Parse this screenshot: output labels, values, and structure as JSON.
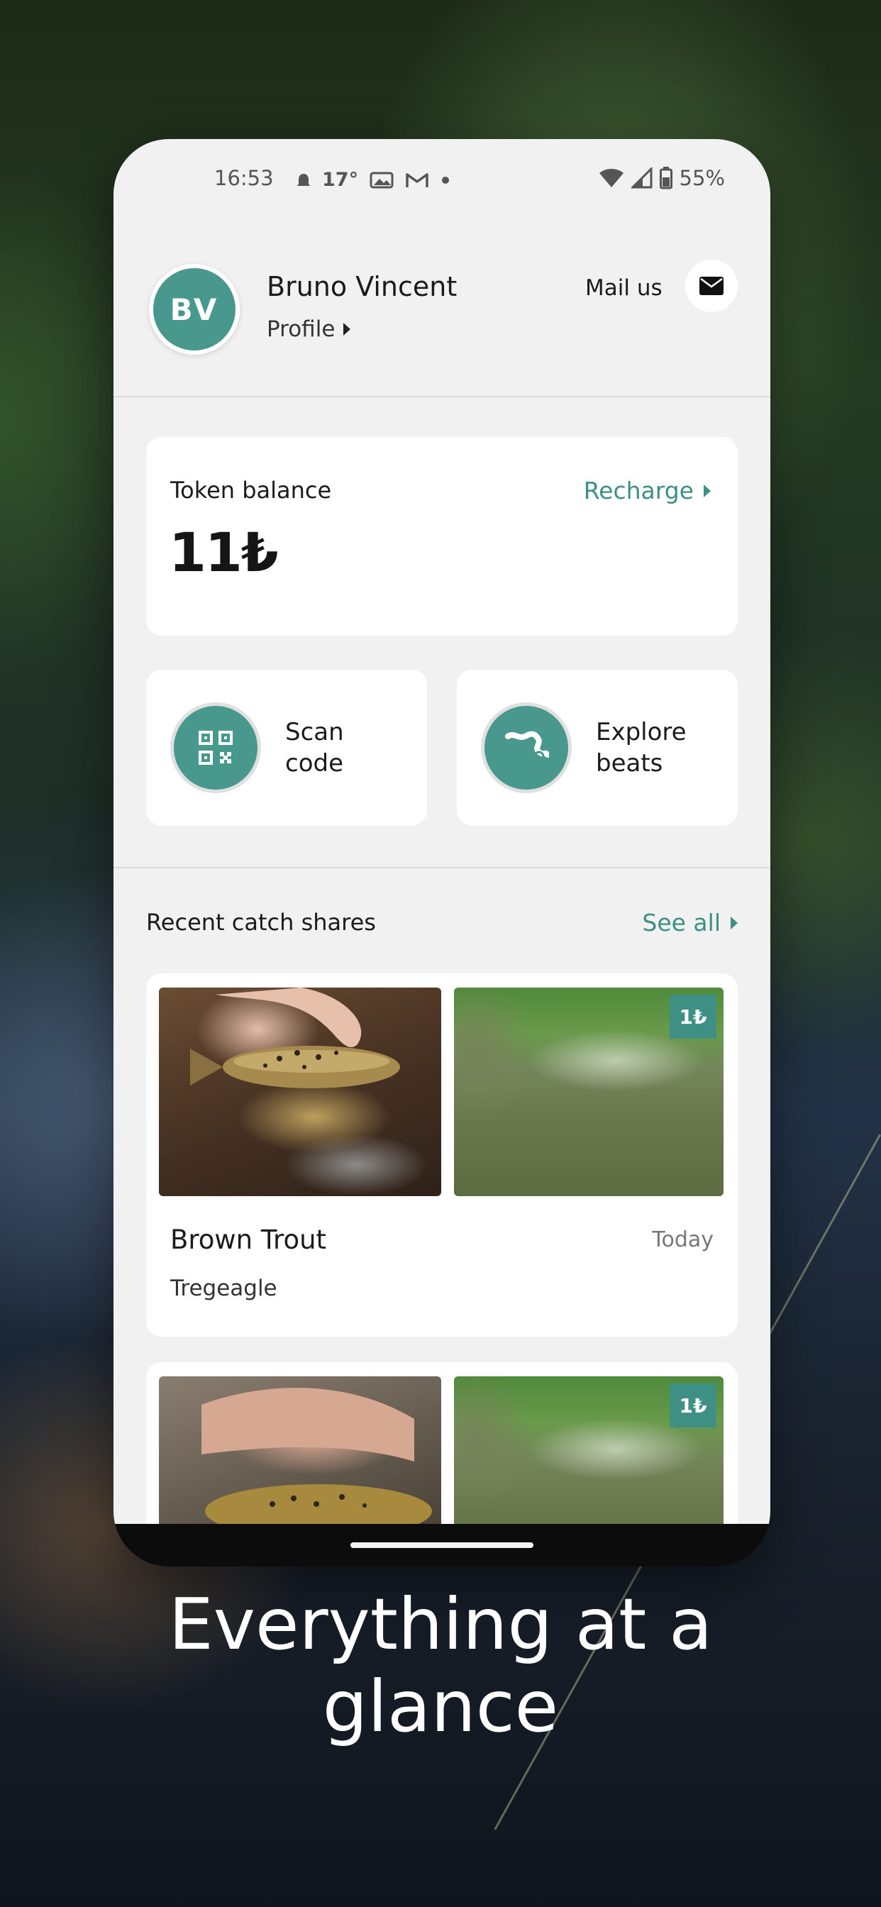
{
  "status_bar": {
    "time": "16:53",
    "temperature": "17°",
    "battery": "55%",
    "icons": [
      "notification-dot-icon",
      "photo-icon",
      "gmail-icon",
      "dot-icon",
      "wifi-icon",
      "signal-icon",
      "battery-icon"
    ]
  },
  "header": {
    "avatar_initials": "BV",
    "user_name": "Bruno Vincent",
    "profile_link": "Profile",
    "mail_label": "Mail us"
  },
  "token_card": {
    "label": "Token balance",
    "recharge": "Recharge",
    "value": "11₺"
  },
  "actions": [
    {
      "label": "Scan code",
      "icon": "qr-code-icon"
    },
    {
      "label": "Explore beats",
      "icon": "river-icon"
    }
  ],
  "recent": {
    "title": "Recent catch shares",
    "see_all": "See all",
    "items": [
      {
        "species": "Brown Trout",
        "date": "Today",
        "location": "Tregeagle",
        "badge": "1₺"
      },
      {
        "badge": "1₺"
      }
    ]
  },
  "caption": {
    "line1": "Everything at a",
    "line2": "glance"
  },
  "colors": {
    "accent": "#3e8f84",
    "avatar": "#48988d",
    "screen_background": "#f1f1f1"
  }
}
